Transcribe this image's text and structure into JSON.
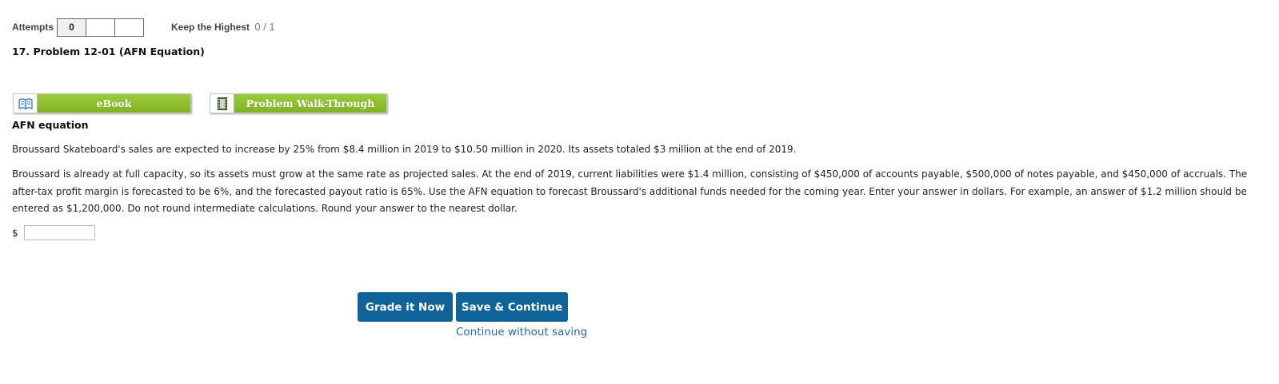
{
  "attempts": {
    "label": "Attempts",
    "boxes": [
      "0",
      "",
      ""
    ]
  },
  "keep_highest": {
    "label": "Keep the Highest",
    "score": "0 / 1"
  },
  "problem": {
    "title": "17.  Problem 12-01 (AFN Equation)"
  },
  "resources": {
    "ebook_label": "eBook",
    "walkthrough_label": "Problem Walk-Through",
    "ebook_icon": "book-icon",
    "walkthrough_icon": "film-icon"
  },
  "content": {
    "section_title": "AFN equation",
    "paragraph1": "Broussard Skateboard's sales are expected to increase by 25% from $8.4 million in 2019 to $10.50 million in 2020. Its assets totaled $3 million at the end of 2019.",
    "paragraph2": "Broussard is already at full capacity, so its assets must grow at the same rate as projected sales. At the end of 2019, current liabilities were $1.4 million, consisting of $450,000 of accounts payable, $500,000 of notes payable, and $450,000 of accruals. The after-tax profit margin is forecasted to be 6%, and the forecasted payout ratio is 65%. Use the AFN equation to forecast Broussard's additional funds needed for the coming year. Enter your answer in dollars. For example, an answer of $1.2 million should be entered as $1,200,000. Do not round intermediate calculations. Round your answer to the nearest dollar."
  },
  "answer": {
    "prefix": "$",
    "value": ""
  },
  "actions": {
    "grade_label": "Grade it Now",
    "save_label": "Save & Continue",
    "continue_label": "Continue without saving"
  },
  "colors": {
    "primary": "#0f6399",
    "resource_green": "#8cc13a",
    "link": "#2d6b99"
  }
}
